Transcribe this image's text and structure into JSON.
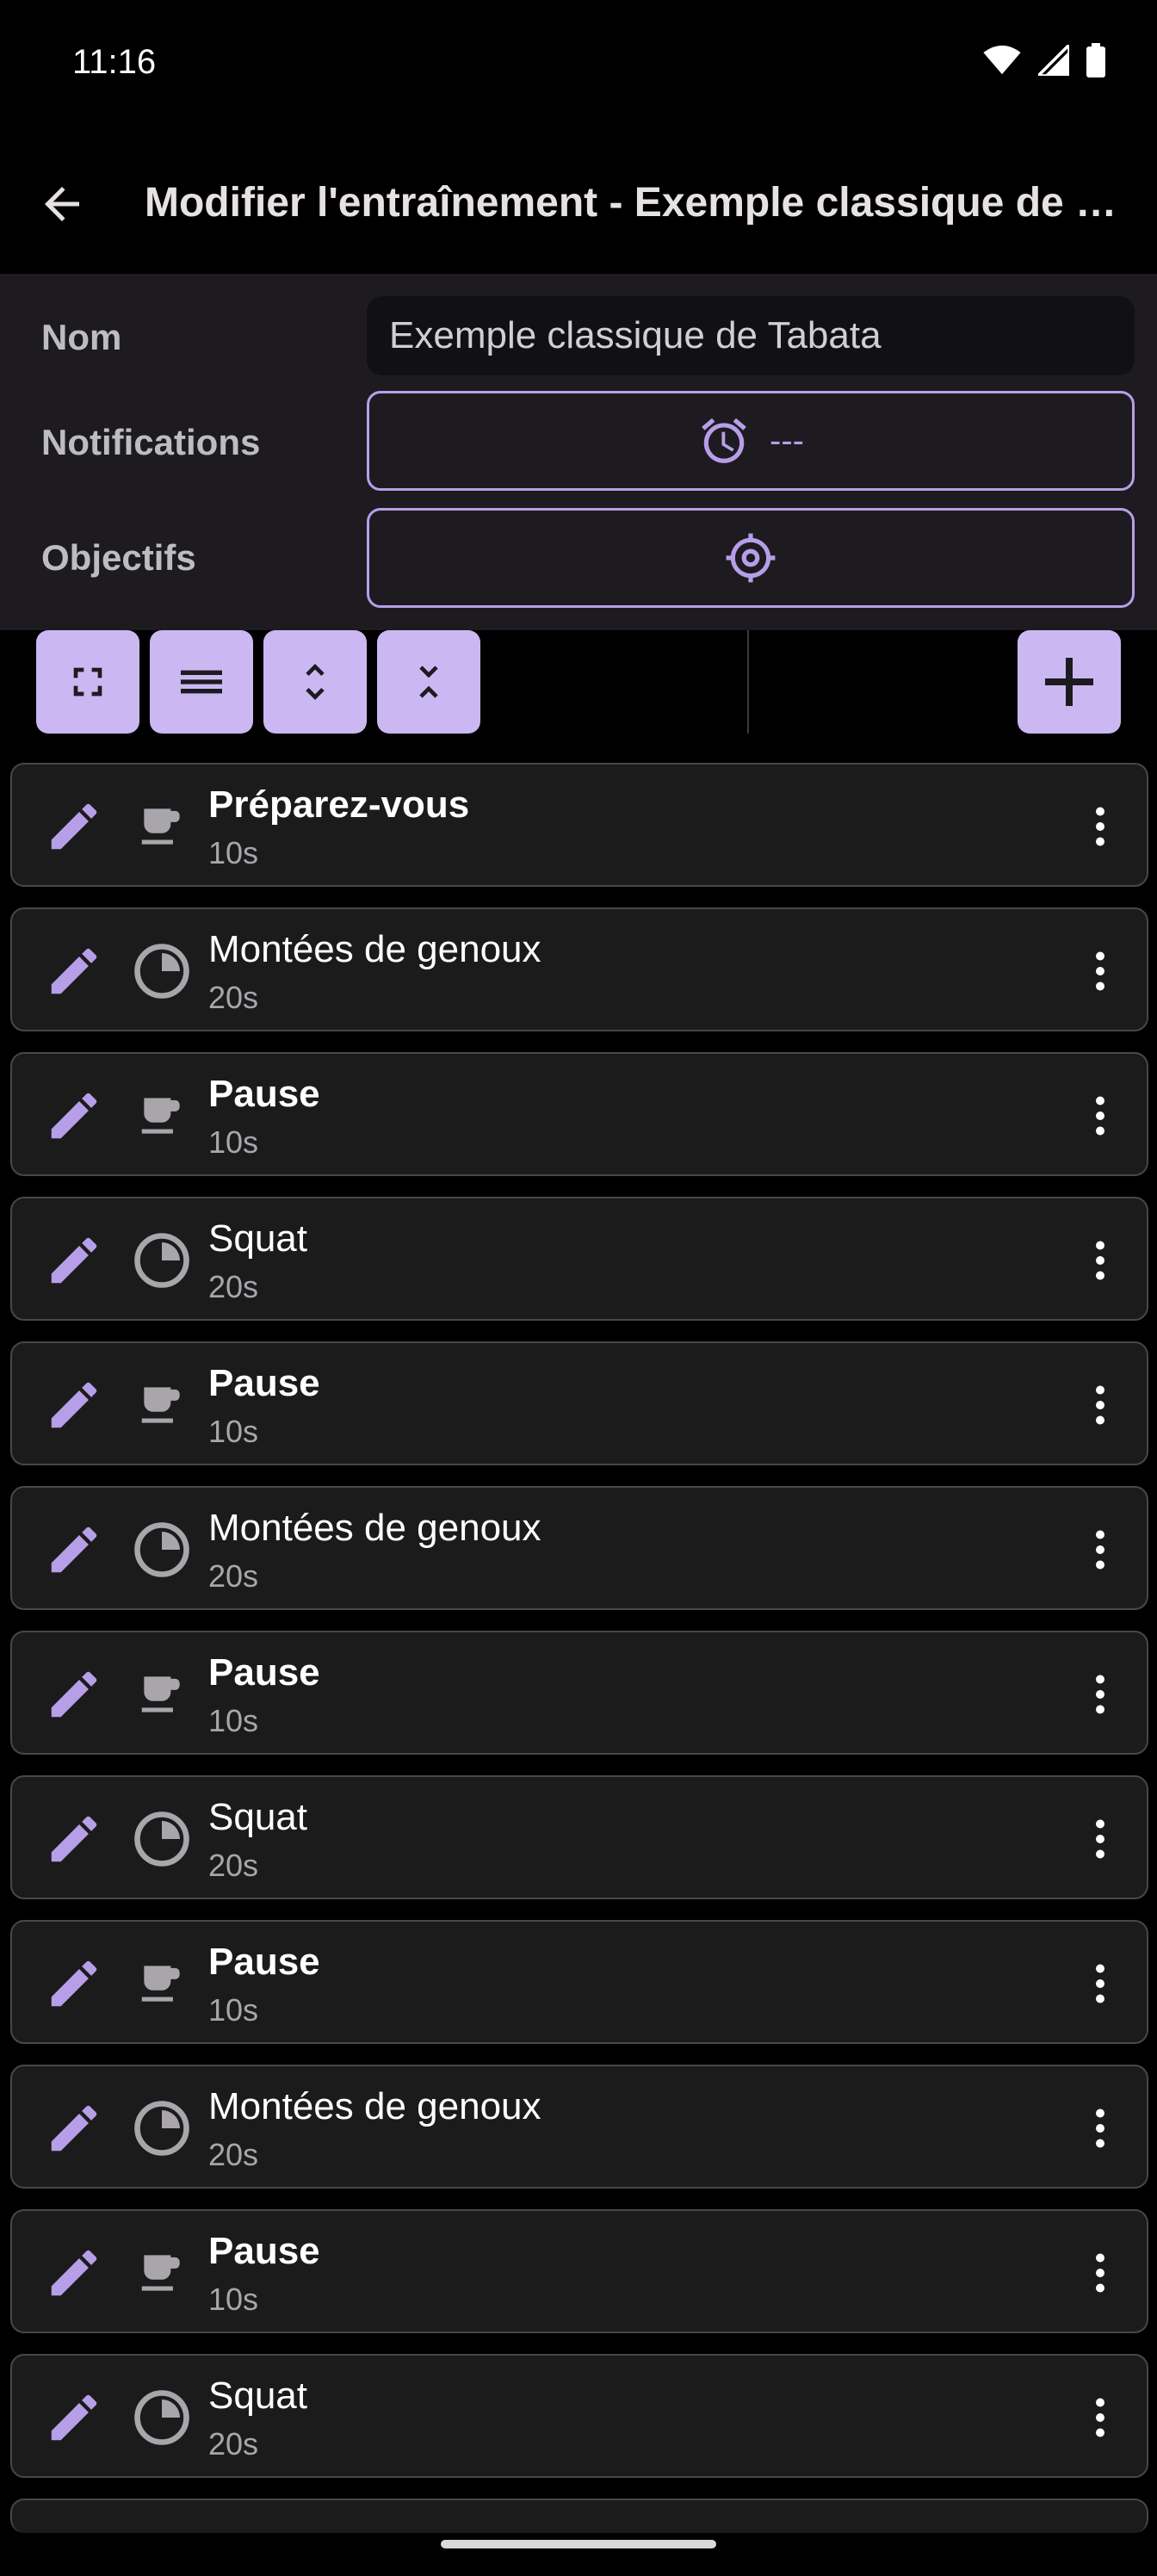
{
  "status_bar": {
    "time": "11:16"
  },
  "app_bar": {
    "title": "Modifier l'entraînement - Exemple classique de Tabata"
  },
  "form": {
    "name_label": "Nom",
    "name_value": "Exemple classique de Tabata",
    "notifications_label": "Notifications",
    "notifications_value": "---",
    "goals_label": "Objectifs"
  },
  "toolbar": {
    "buttons": [
      "fullscreen-icon",
      "list-icon",
      "expand-icon",
      "collapse-icon"
    ],
    "add_icon": "plus-icon"
  },
  "items": [
    {
      "title": "Préparez-vous",
      "duration": "10s",
      "type": "rest",
      "bold": true
    },
    {
      "title": "Montées de genoux",
      "duration": "20s",
      "type": "exercise",
      "bold": false
    },
    {
      "title": "Pause",
      "duration": "10s",
      "type": "rest",
      "bold": true
    },
    {
      "title": "Squat",
      "duration": "20s",
      "type": "exercise",
      "bold": false
    },
    {
      "title": "Pause",
      "duration": "10s",
      "type": "rest",
      "bold": true
    },
    {
      "title": "Montées de genoux",
      "duration": "20s",
      "type": "exercise",
      "bold": false
    },
    {
      "title": "Pause",
      "duration": "10s",
      "type": "rest",
      "bold": true
    },
    {
      "title": "Squat",
      "duration": "20s",
      "type": "exercise",
      "bold": false
    },
    {
      "title": "Pause",
      "duration": "10s",
      "type": "rest",
      "bold": true
    },
    {
      "title": "Montées de genoux",
      "duration": "20s",
      "type": "exercise",
      "bold": false
    },
    {
      "title": "Pause",
      "duration": "10s",
      "type": "rest",
      "bold": true
    },
    {
      "title": "Squat",
      "duration": "20s",
      "type": "exercise",
      "bold": false
    }
  ],
  "colors": {
    "accent": "#cbb8f2",
    "accent_outline": "#b79ee8",
    "panel": "#1d1b20"
  }
}
